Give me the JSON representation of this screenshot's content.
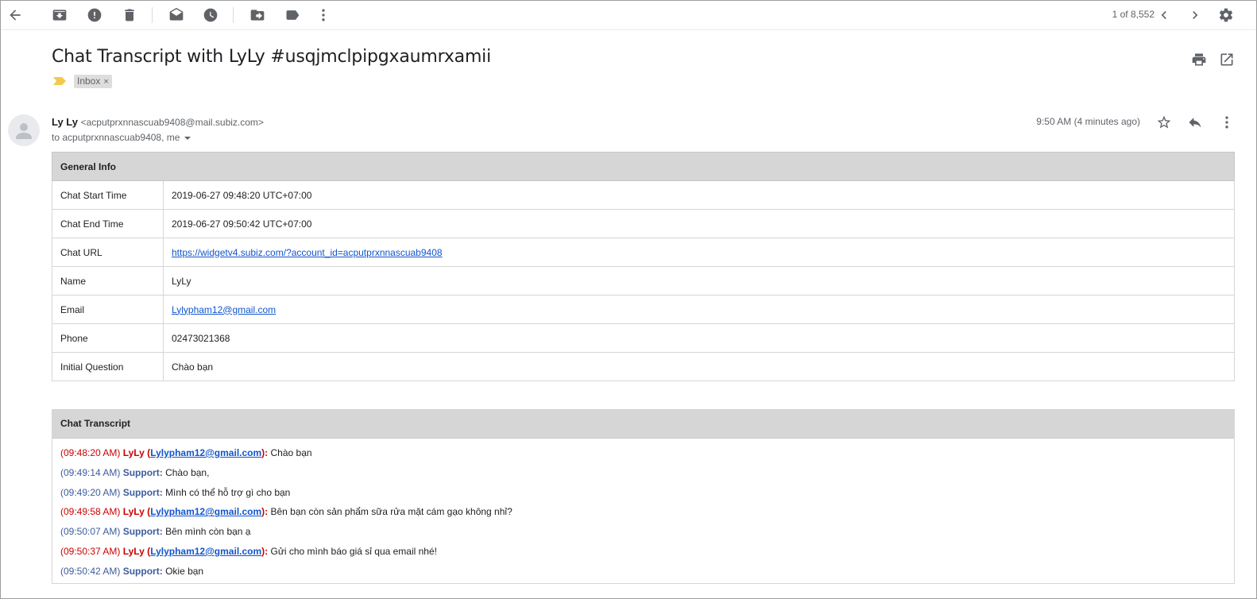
{
  "toolbar": {
    "pager": "1 of 8,552"
  },
  "email": {
    "subject": "Chat Transcript with LyLy #usqjmclpipgxaumrxamii",
    "label": "Inbox",
    "label_close": "×",
    "sender_name": "Ly Ly",
    "sender_email": "<acputprxnnascuab9408@mail.subiz.com>",
    "recipients": "to acputprxnnascuab9408, me",
    "time": "9:50 AM (4 minutes ago)"
  },
  "general_info": {
    "header": "General Info",
    "rows": [
      {
        "key": "Chat Start Time",
        "value": "2019-06-27 09:48:20 UTC+07:00",
        "link": false
      },
      {
        "key": "Chat End Time",
        "value": "2019-06-27 09:50:42 UTC+07:00",
        "link": false
      },
      {
        "key": "Chat URL",
        "value": "https://widgetv4.subiz.com/?account_id=acputprxnnascuab9408",
        "link": true
      },
      {
        "key": "Name",
        "value": "LyLy",
        "link": false
      },
      {
        "key": "Email",
        "value": "Lylypham12@gmail.com",
        "link": true
      },
      {
        "key": "Phone",
        "value": "02473021368",
        "link": false
      },
      {
        "key": "Initial Question",
        "value": "Chào bạn",
        "link": false
      }
    ]
  },
  "transcript": {
    "header": "Chat Transcript",
    "messages": [
      {
        "time": "(09:48:20 AM)",
        "who": "LyLy",
        "visitor": true,
        "email": "Lylypham12@gmail.com",
        "text": "Chào bạn"
      },
      {
        "time": "(09:49:14 AM)",
        "who": "Support",
        "visitor": false,
        "email": "",
        "text": "Chào bạn,"
      },
      {
        "time": "(09:49:20 AM)",
        "who": "Support",
        "visitor": false,
        "email": "",
        "text": "Mình có thể hỗ trợ gì cho bạn"
      },
      {
        "time": "(09:49:58 AM)",
        "who": "LyLy",
        "visitor": true,
        "email": "Lylypham12@gmail.com",
        "text": "Bên bạn còn sản phẩm sữa rửa mặt cám gạo không nhỉ?"
      },
      {
        "time": "(09:50:07 AM)",
        "who": "Support",
        "visitor": false,
        "email": "",
        "text": "Bên mình còn bạn ạ"
      },
      {
        "time": "(09:50:37 AM)",
        "who": "LyLy",
        "visitor": true,
        "email": "Lylypham12@gmail.com",
        "text": "Gửi cho mình báo giá sỉ qua email nhé!"
      },
      {
        "time": "(09:50:42 AM)",
        "who": "Support",
        "visitor": false,
        "email": "",
        "text": "Okie bạn"
      }
    ]
  },
  "icons": {
    "toolbar": [
      "back-arrow-icon",
      "archive-icon",
      "report-spam-icon",
      "delete-icon",
      "mark-unread-icon",
      "snooze-icon",
      "move-to-icon",
      "label-icon",
      "more-vert-icon",
      "chevron-left-icon",
      "chevron-right-icon",
      "settings-gear-icon"
    ],
    "header": [
      "print-icon",
      "open-in-new-window-icon",
      "star-icon",
      "reply-icon",
      "more-vert-icon"
    ]
  },
  "colors": {
    "link": "#1155cc",
    "visitor": "#cc0000",
    "support": "#3c5c9c",
    "table_header_bg": "#d6d6d6",
    "importance_marker": "#f2c94c"
  }
}
